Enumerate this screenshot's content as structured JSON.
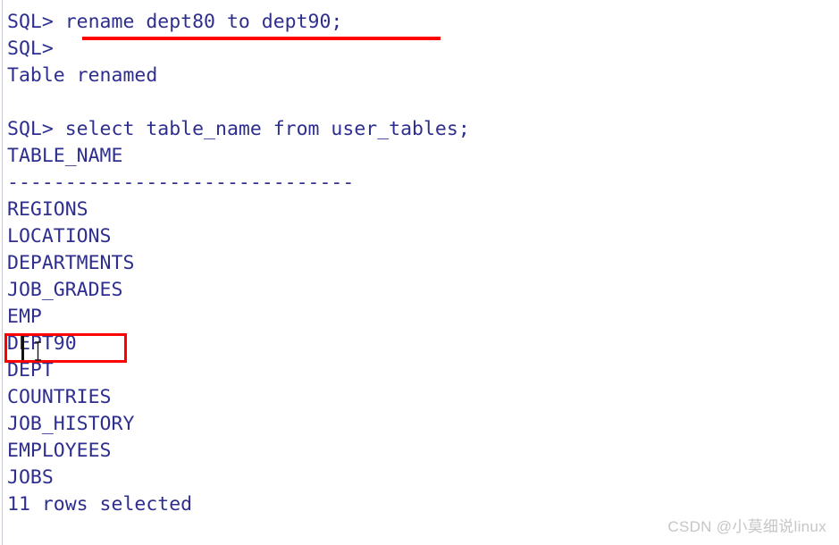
{
  "terminal": {
    "name": "sqlplus-console",
    "background_color": "#ffffff",
    "text_color": "#2e2e8f",
    "lines": [
      {
        "id": "line-rename-command",
        "text": "SQL> rename dept80 to dept90;"
      },
      {
        "id": "line-prompt-empty",
        "text": "SQL>"
      },
      {
        "id": "line-table-renamed",
        "text": "Table renamed"
      },
      {
        "id": "line-blank-1",
        "text": " "
      },
      {
        "id": "line-select-command",
        "text": "SQL> select table_name from user_tables;"
      },
      {
        "id": "line-column-header",
        "text": "TABLE_NAME"
      },
      {
        "id": "line-header-rule",
        "text": "------------------------------"
      },
      {
        "id": "line-row-regions",
        "text": "REGIONS"
      },
      {
        "id": "line-row-locations",
        "text": "LOCATIONS"
      },
      {
        "id": "line-row-departments",
        "text": "DEPARTMENTS"
      },
      {
        "id": "line-row-job-grades",
        "text": "JOB_GRADES"
      },
      {
        "id": "line-row-emp",
        "text": "EMP"
      },
      {
        "id": "line-row-dept90",
        "text": "DEPT90"
      },
      {
        "id": "line-row-dept",
        "text": "DEPT"
      },
      {
        "id": "line-row-countries",
        "text": "COUNTRIES"
      },
      {
        "id": "line-row-job-history",
        "text": "JOB_HISTORY"
      },
      {
        "id": "line-row-employees",
        "text": "EMPLOYEES"
      },
      {
        "id": "line-row-jobs",
        "text": "JOBS"
      },
      {
        "id": "line-rows-selected",
        "text": "11 rows selected"
      }
    ]
  },
  "annotations": {
    "color": "#fe0000",
    "rename_underline": {
      "label": "rename dept80 to dept90;",
      "kind": "underline"
    },
    "dept90_box": {
      "label": "DEPT90",
      "kind": "rectangle"
    }
  },
  "cursor": {
    "caret_name": "text-caret",
    "pointer_name": "ibeam-cursor"
  },
  "watermark": {
    "text": "CSDN @小莫细说linux",
    "color": "#c6c6c6"
  }
}
